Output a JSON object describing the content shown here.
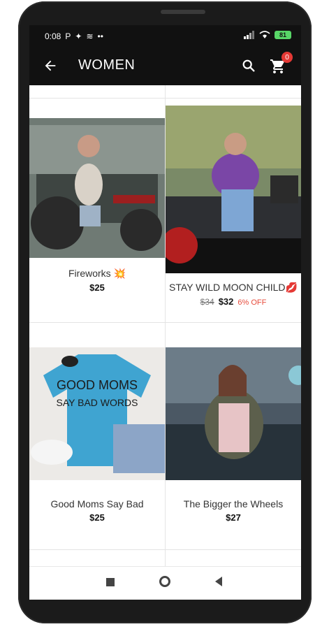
{
  "status": {
    "time": "0:08",
    "left_icons": [
      "P",
      "✦",
      "≋",
      "••"
    ],
    "battery": "81"
  },
  "appbar": {
    "title": "WOMEN",
    "cart_count": "0"
  },
  "products": [
    {
      "name": "Fireworks 💥",
      "price": "$25"
    },
    {
      "name": "STAY WILD MOON CHILD💋",
      "old_price": "$34",
      "price": "$32",
      "discount": "6% OFF"
    },
    {
      "name": "Good Moms Say Bad",
      "price": "$25"
    },
    {
      "name": "The Bigger the Wheels",
      "price": "$27"
    }
  ],
  "colors": {
    "appbar": "#111111",
    "badge": "#e53935",
    "discount": "#e74c3c",
    "battery": "#58d667"
  }
}
